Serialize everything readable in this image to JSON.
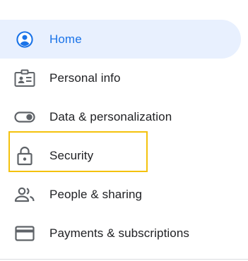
{
  "sidebar": {
    "items": [
      {
        "label": "Home",
        "icon": "account-circle-icon",
        "active": true
      },
      {
        "label": "Personal info",
        "icon": "id-card-icon",
        "active": false
      },
      {
        "label": "Data & personalization",
        "icon": "toggle-icon",
        "active": false
      },
      {
        "label": "Security",
        "icon": "lock-icon",
        "active": false,
        "highlighted": true
      },
      {
        "label": "People & sharing",
        "icon": "people-icon",
        "active": false
      },
      {
        "label": "Payments & subscriptions",
        "icon": "credit-card-icon",
        "active": false
      }
    ]
  },
  "colors": {
    "accent": "#1a73e8",
    "active_bg": "#e8f0fe",
    "icon": "#5f6368",
    "text": "#202124",
    "highlight": "#f4c20d"
  }
}
